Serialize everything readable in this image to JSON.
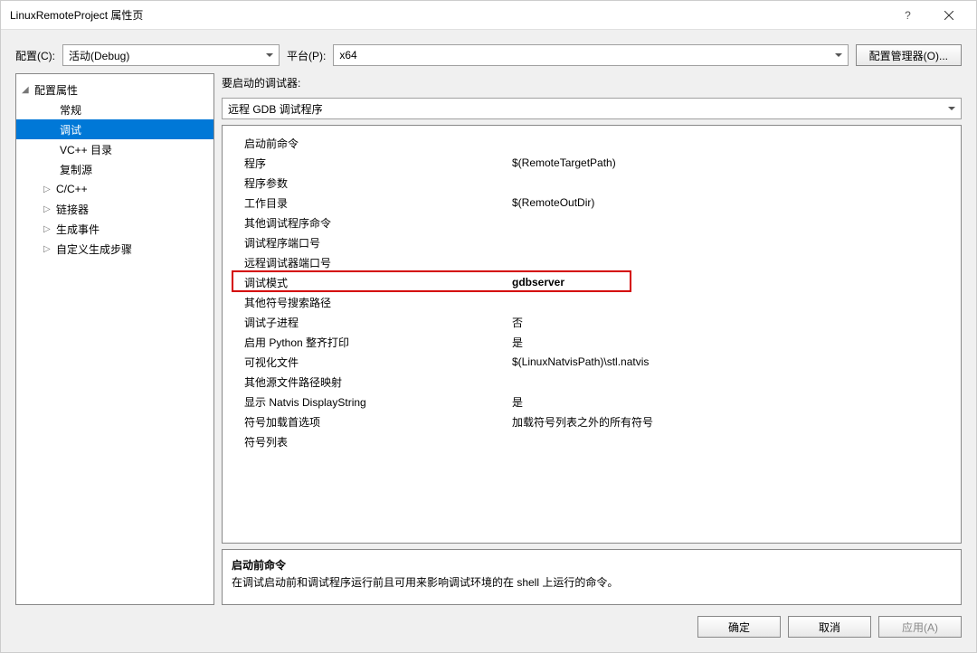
{
  "titlebar": {
    "title": "LinuxRemoteProject 属性页",
    "help": "?"
  },
  "config_row": {
    "config_label": "配置(C):",
    "config_value": "活动(Debug)",
    "platform_label": "平台(P):",
    "platform_value": "x64",
    "config_manager": "配置管理器(O)..."
  },
  "tree": {
    "root": "配置属性",
    "items": {
      "general": "常规",
      "debug": "调试",
      "vcdirs": "VC++ 目录",
      "copysrc": "复制源",
      "ccpp": "C/C++",
      "linker": "链接器",
      "buildevt": "生成事件",
      "custombuild": "自定义生成步骤"
    }
  },
  "right": {
    "debugger_label": "要启动的调试器:",
    "debugger_value": "远程 GDB 调试程序"
  },
  "props": [
    {
      "name": "启动前命令",
      "value": ""
    },
    {
      "name": "程序",
      "value": "$(RemoteTargetPath)"
    },
    {
      "name": "程序参数",
      "value": ""
    },
    {
      "name": "工作目录",
      "value": "$(RemoteOutDir)"
    },
    {
      "name": "其他调试程序命令",
      "value": ""
    },
    {
      "name": "调试程序端口号",
      "value": ""
    },
    {
      "name": "远程调试器端口号",
      "value": ""
    },
    {
      "name": "调试模式",
      "value": "gdbserver",
      "highlight": true,
      "bold": true
    },
    {
      "name": "其他符号搜索路径",
      "value": ""
    },
    {
      "name": "调试子进程",
      "value": "否"
    },
    {
      "name": "启用 Python 整齐打印",
      "value": "是"
    },
    {
      "name": "可视化文件",
      "value": "$(LinuxNatvisPath)\\stl.natvis"
    },
    {
      "name": "其他源文件路径映射",
      "value": ""
    },
    {
      "name": "显示 Natvis DisplayString",
      "value": "是"
    },
    {
      "name": "符号加载首选项",
      "value": "加载符号列表之外的所有符号"
    },
    {
      "name": "符号列表",
      "value": ""
    }
  ],
  "desc": {
    "title": "启动前命令",
    "text": "在调试启动前和调试程序运行前且可用来影响调试环境的在 shell 上运行的命令。"
  },
  "footer": {
    "ok": "确定",
    "cancel": "取消",
    "apply": "应用(A)"
  }
}
